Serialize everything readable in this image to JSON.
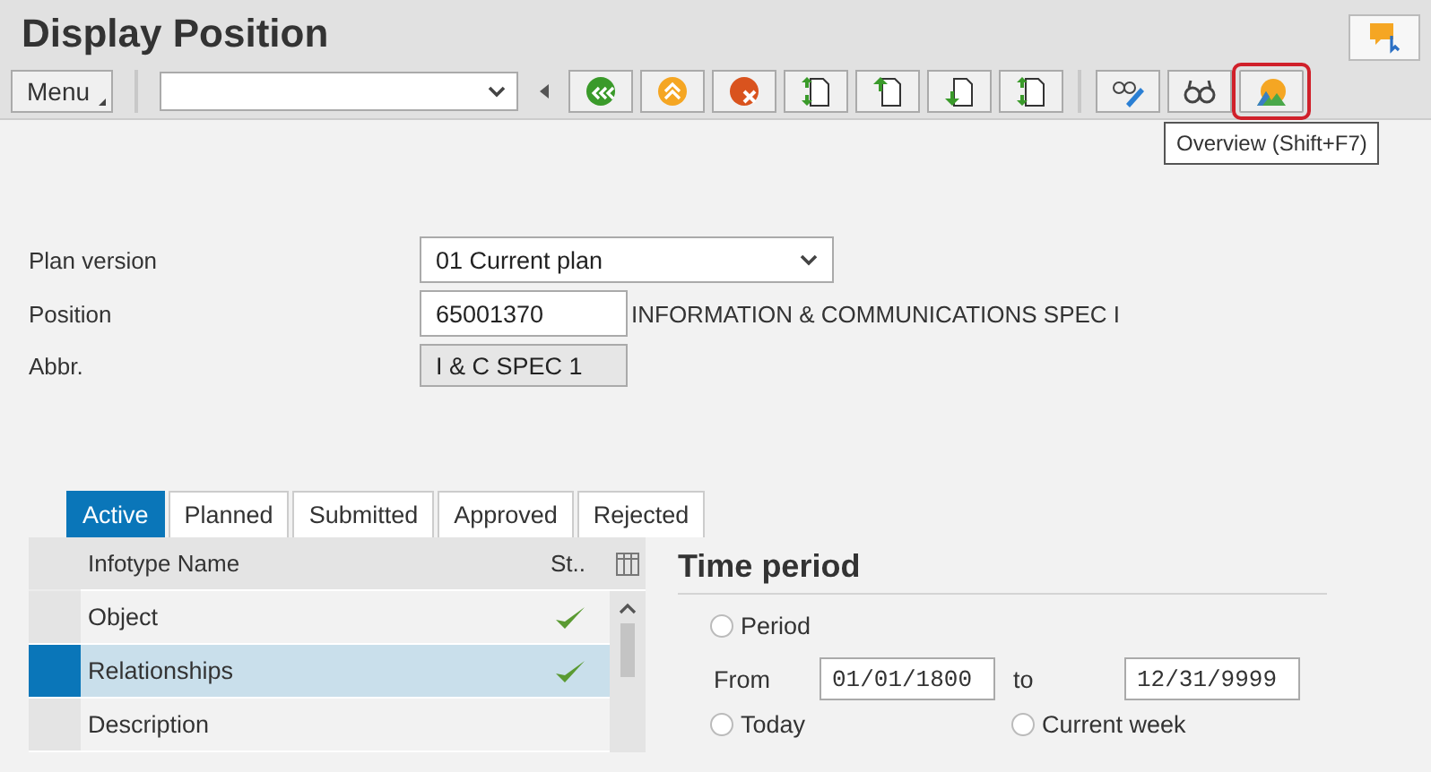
{
  "window": {
    "title": "Display Position"
  },
  "toolbar": {
    "menu": "Menu",
    "buttons": [
      {
        "highlighted": false
      },
      {
        "highlighted": false
      },
      {
        "highlighted": false
      },
      {
        "highlighted": false
      },
      {
        "highlighted": false
      },
      {
        "highlighted": false
      },
      {
        "highlighted": false
      }
    ],
    "view_buttons": [
      {
        "highlighted": false
      },
      {
        "highlighted": false
      },
      {
        "highlighted": true
      }
    ],
    "tooltip": "Overview (Shift+F7)"
  },
  "form": {
    "plan_version": {
      "label": "Plan version",
      "value": "01 Current plan"
    },
    "position": {
      "label": "Position",
      "value": "65001370",
      "description": "INFORMATION & COMMUNICATIONS SPEC I"
    },
    "abbr": {
      "label": "Abbr.",
      "value": "I & C SPEC 1"
    }
  },
  "tabs": [
    {
      "label": "Active",
      "selected": true
    },
    {
      "label": "Planned",
      "selected": false
    },
    {
      "label": "Submitted",
      "selected": false
    },
    {
      "label": "Approved",
      "selected": false
    },
    {
      "label": "Rejected",
      "selected": false
    }
  ],
  "table": {
    "columns": [
      "Infotype Name",
      "St.."
    ],
    "rows": [
      {
        "name": "Object",
        "checked": true,
        "selected": false
      },
      {
        "name": "Relationships",
        "checked": true,
        "selected": true
      },
      {
        "name": "Description",
        "checked": false,
        "selected": false
      }
    ]
  },
  "time_period": {
    "title": "Time period",
    "period": {
      "label": "Period",
      "selected": false
    },
    "from_label": "From",
    "from": "01/01/1800",
    "to_label": "to",
    "to": "12/31/9999",
    "today": {
      "label": "Today",
      "selected": false
    },
    "current_week": {
      "label": "Current week",
      "selected": false
    }
  }
}
